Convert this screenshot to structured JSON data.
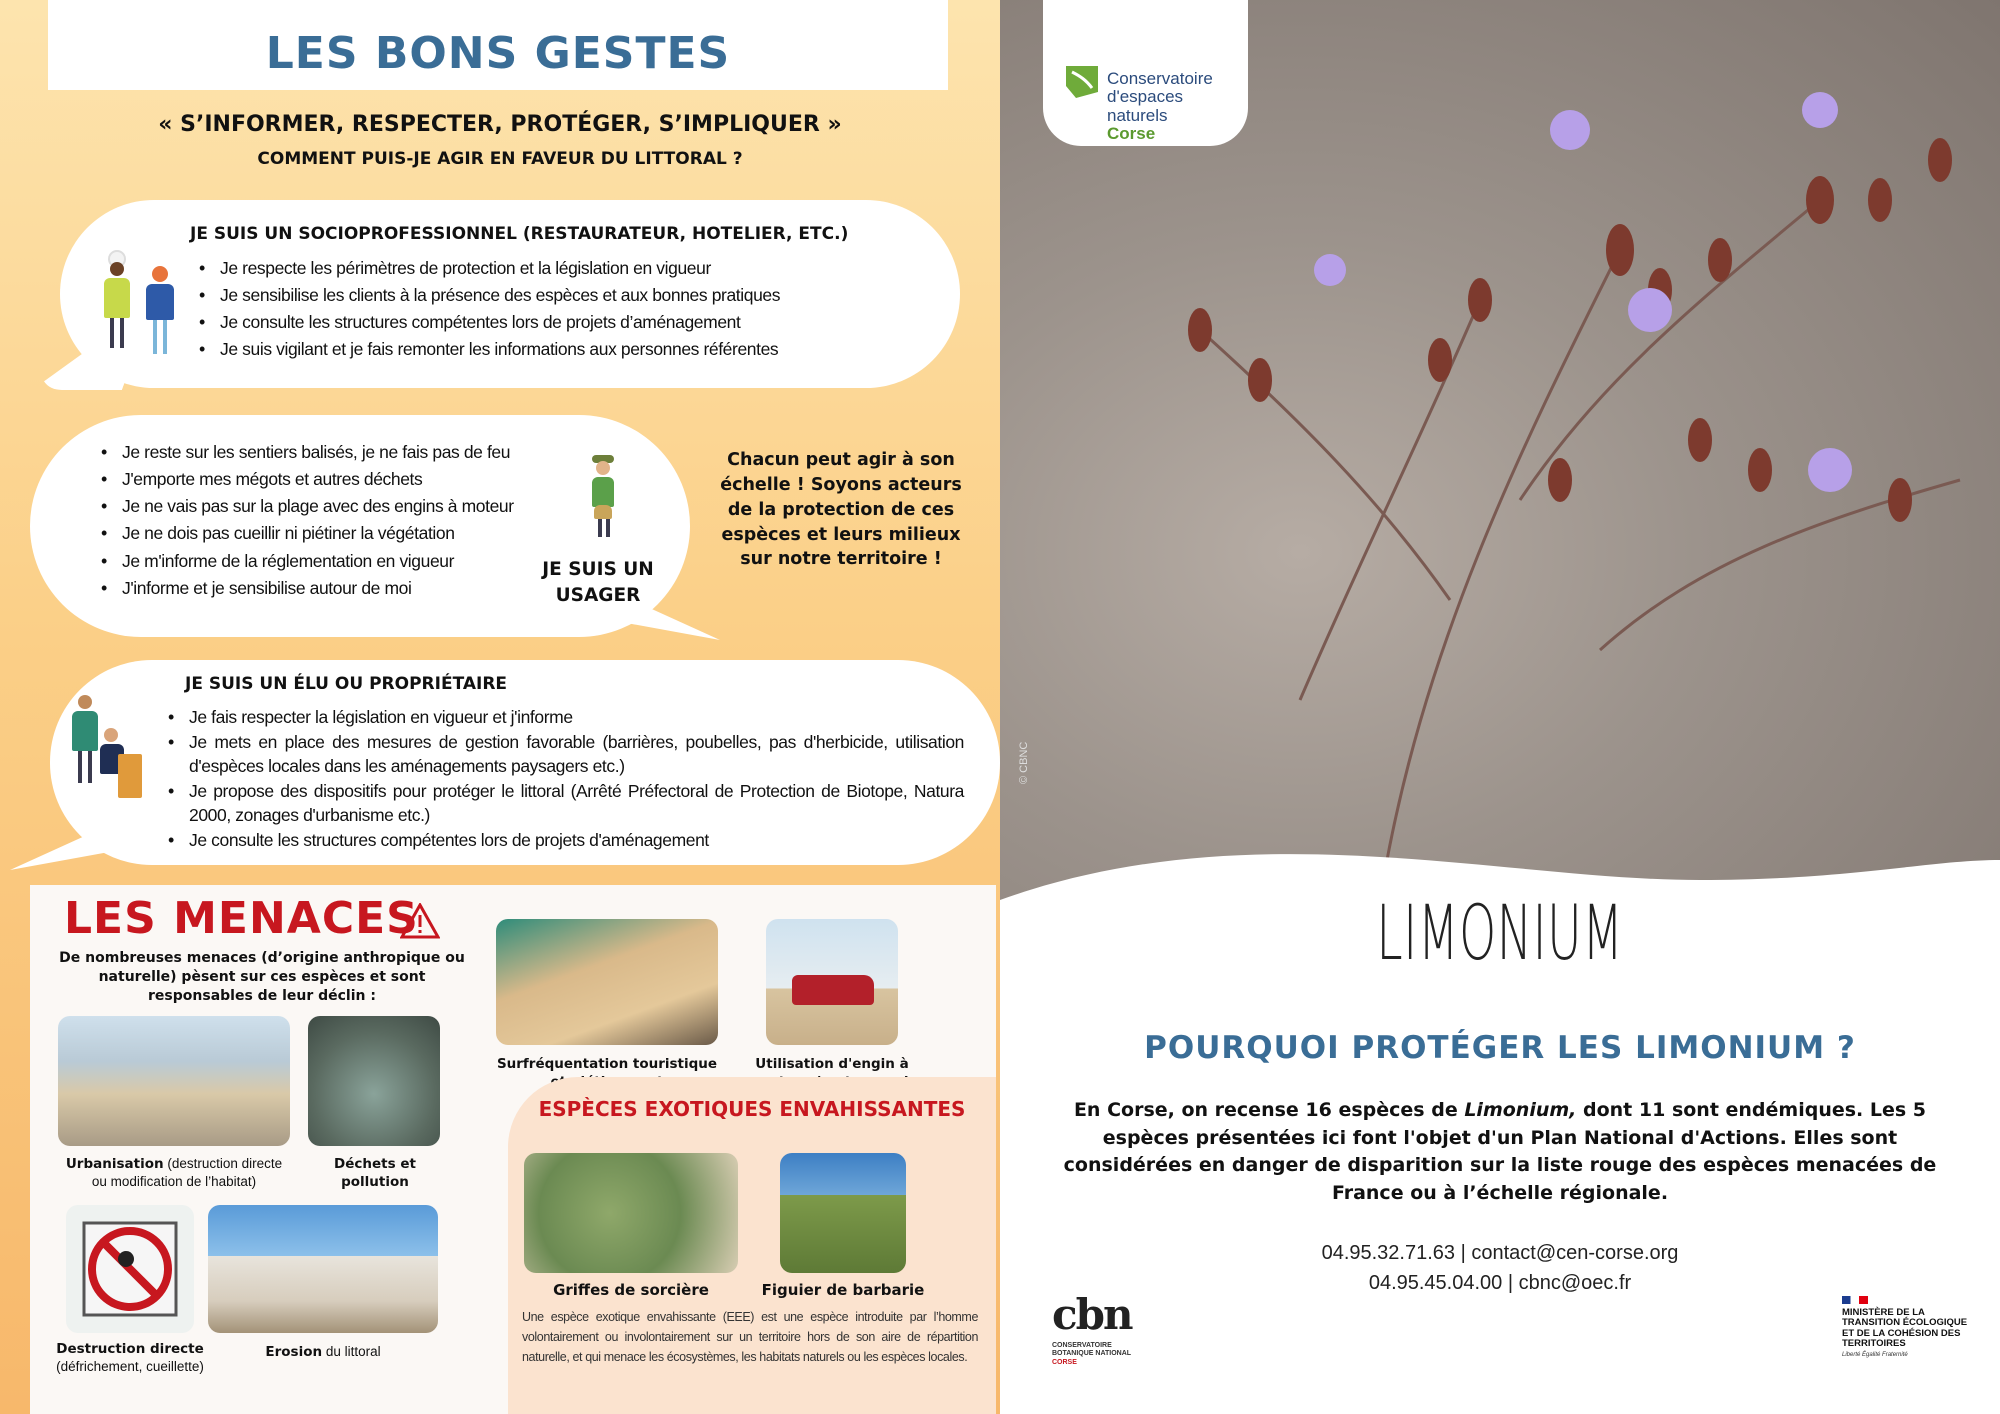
{
  "left": {
    "title": "LES BONS GESTES",
    "slogan": "« S’INFORMER, RESPECTER, PROTÉGER, S’IMPLIQUER »",
    "subslogan": "COMMENT PUIS-JE AGIR EN FAVEUR DU LITTORAL ?",
    "socio": {
      "heading": "JE SUIS UN SOCIOPROFESSIONNEL (RESTAURATEUR, HOTELIER, ETC.)",
      "items": [
        "Je respecte les périmètres de protection et la législation en vigueur",
        "Je sensibilise les clients à la présence des espèces et aux bonnes pratiques",
        "Je consulte les structures compétentes lors de projets d’aménagement",
        "Je suis vigilant et je fais remonter les informations aux personnes référentes"
      ]
    },
    "usager": {
      "heading_line1": "JE SUIS UN",
      "heading_line2": "USAGER",
      "items": [
        "Je reste sur les sentiers balisés, je ne fais pas de feu",
        "J'emporte mes mégots et autres déchets",
        "Je ne vais pas sur la plage avec des engins à moteur",
        "Je ne dois pas cueillir ni piétiner la végétation",
        "Je m'informe de la réglementation en vigueur",
        "J'informe et je sensibilise autour de moi"
      ]
    },
    "chacun": "Chacun peut agir à son échelle ! Soyons acteurs de la protection de ces espèces et leurs milieux sur notre territoire !",
    "elu": {
      "heading": "JE SUIS UN ÉLU OU PROPRIÉTAIRE",
      "items": [
        "Je fais respecter la législation en vigueur et  j'informe",
        "Je mets en place des mesures de gestion favorable (barrières, poubelles, pas d'herbicide, utilisation d'espèces locales dans les aménagements paysagers etc.)",
        "Je propose des dispositifs pour protéger le littoral (Arrêté Préfectoral de Protection de Biotope, Natura 2000, zonages  d'urbanisme etc.)",
        "Je consulte les structures compétentes lors de projets d'aménagement"
      ]
    },
    "menaces": {
      "title": "LES MENACES",
      "intro": "De nombreuses menaces (d’origine anthropique ou naturelle) pèsent sur ces espèces et sont responsables de leur déclin :",
      "urbanisation_bold": "Urbanisation",
      "urbanisation_rest": " (destruction directe ou modification de l’habitat)",
      "dechets": "Déchets et pollution",
      "destruction_bold": "Destruction directe",
      "destruction_rest": "(défrichement, cueillette)",
      "erosion_bold": "Erosion",
      "erosion_rest": " du littoral",
      "surfreq": "Surfréquentation touristique et piétinement",
      "engin": "Utilisation d'engin à moteur (moto, quad etc)",
      "eee_title": "ESPÈCES EXOTIQUES ENVAHISSANTES",
      "griffes": "Griffes de sorcière",
      "figuier": "Figuier de barbarie",
      "eee_text": "Une espèce exotique envahissante (EEE) est une espèce introduite par l’homme volontairement ou involontairement sur un territoire hors de son aire de répartition naturelle, et qui menace les écosystèmes, les habitats naturels ou les espèces locales."
    }
  },
  "right": {
    "logo_line1": "Conservatoire",
    "logo_line2": "d'espaces naturels",
    "logo_line3": "Corse",
    "credit": "© CBNC",
    "title": "LIMONIUM",
    "question": "POURQUOI PROTÉGER LES LIMONIUM ?",
    "desc_before": "En Corse, on recense 16 espèces de ",
    "desc_italic": "Limonium,",
    "desc_after": " dont 11 sont endémiques. Les 5 espèces présentées ici font l'objet d'un Plan National d'Actions. Elles sont considérées en danger de disparition sur la liste rouge des espèces menacées de France ou à l’échelle régionale.",
    "contact1": "04.95.32.71.63 | contact@cen-corse.org",
    "contact2": "04.95.45.04.00 | cbnc@oec.fr",
    "cbn_main": "cbn",
    "cbn_sub1": "CONSERVATOIRE",
    "cbn_sub2": "BOTANIQUE NATIONAL",
    "cbn_sub3": "CORSE",
    "ministere": "MINISTÈRE DE LA TRANSITION ÉCOLOGIQUE ET DE LA COHÉSION DES TERRITOIRES",
    "motto": "Liberté Égalité Fraternité"
  }
}
